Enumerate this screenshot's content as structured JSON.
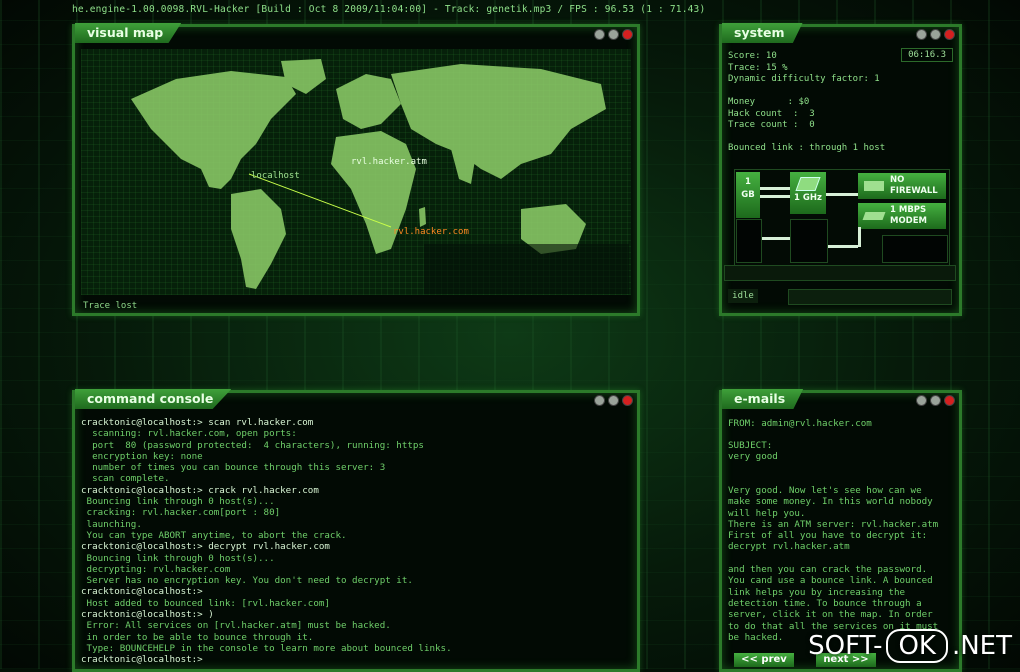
{
  "topbar": "he.engine-1.00.0098.RVL-Hacker [Build : Oct  8 2009/11:04:00] - Track: genetik.mp3 / FPS : 96.53 (1 : 71.43)",
  "visual_map": {
    "title": "visual map",
    "localhost": "localhost",
    "atm": "rvl.hacker.atm",
    "com": "rvl.hacker.com",
    "status": "Trace lost"
  },
  "system": {
    "title": "system",
    "timer": "06:16.3",
    "lines": [
      "Score: 10",
      "Trace: 15 %",
      "Dynamic difficulty factor: 1",
      "",
      "Money      : $0",
      "Hack count  :  3",
      "Trace count :  0",
      "",
      "Bounced link : through 1 host"
    ],
    "hw_ram": "1\nGB",
    "hw_cpu": "1 GHz",
    "hw_fw": "NO\nFIREWALL",
    "hw_modem": "1 MBPS\nMODEM",
    "idle": "idle"
  },
  "console": {
    "title": "command console",
    "lines": [
      {
        "t": "cracktonic@localhost:> scan rvl.hacker.com",
        "p": true
      },
      {
        "t": "  scanning: rvl.hacker.com, open ports:",
        "p": false
      },
      {
        "t": "  port  80 (password protected:  4 characters), running: https",
        "p": false
      },
      {
        "t": "  encryption key: none",
        "p": false
      },
      {
        "t": "  number of times you can bounce through this server: 3",
        "p": false
      },
      {
        "t": "  scan complete.",
        "p": false
      },
      {
        "t": "cracktonic@localhost:> crack rvl.hacker.com",
        "p": true
      },
      {
        "t": " Bouncing link through 0 host(s)...",
        "p": false
      },
      {
        "t": " cracking: rvl.hacker.com[port : 80]",
        "p": false
      },
      {
        "t": " launching.",
        "p": false
      },
      {
        "t": " You can type ABORT anytime, to abort the crack.",
        "p": false
      },
      {
        "t": "cracktonic@localhost:> decrypt rvl.hacker.com",
        "p": true
      },
      {
        "t": " Bouncing link through 0 host(s)...",
        "p": false
      },
      {
        "t": " decrypting: rvl.hacker.com",
        "p": false
      },
      {
        "t": " Server has no encryption key. You don't need to decrypt it.",
        "p": false
      },
      {
        "t": "cracktonic@localhost:>",
        "p": true
      },
      {
        "t": " Host added to bounced link: [rvl.hacker.com]",
        "p": false
      },
      {
        "t": "cracktonic@localhost:> )",
        "p": true
      },
      {
        "t": " Error: All services on [rvl.hacker.atm] must be hacked.",
        "p": false
      },
      {
        "t": " in order to be able to bounce through it.",
        "p": false
      },
      {
        "t": " Type: BOUNCEHELP in the console to learn more about bounced links.",
        "p": false
      },
      {
        "t": "cracktonic@localhost:>",
        "p": true
      }
    ]
  },
  "emails": {
    "title": "e-mails",
    "from": "FROM: admin@rvl.hacker.com",
    "subject_label": "SUBJECT:",
    "subject": "very good",
    "body": [
      "Very good. Now let's see how can we",
      "make some money. In this world nobody",
      "will help you.",
      "There is an ATM server: rvl.hacker.atm",
      "First of all you have to decrypt it:",
      "decrypt rvl.hacker.atm",
      "",
      "and then you can crack the password.",
      "You cand use a bounce link. A bounced",
      "link helps you by increasing the",
      "detection time. To bounce through a",
      "server, click it on the map. In order",
      "to do that all the services on it must",
      "be hacked."
    ],
    "prev": "<< prev",
    "next": "next >>"
  },
  "watermark": {
    "left": "SOFT-",
    "ok": "OK",
    ".net": ".NET"
  }
}
